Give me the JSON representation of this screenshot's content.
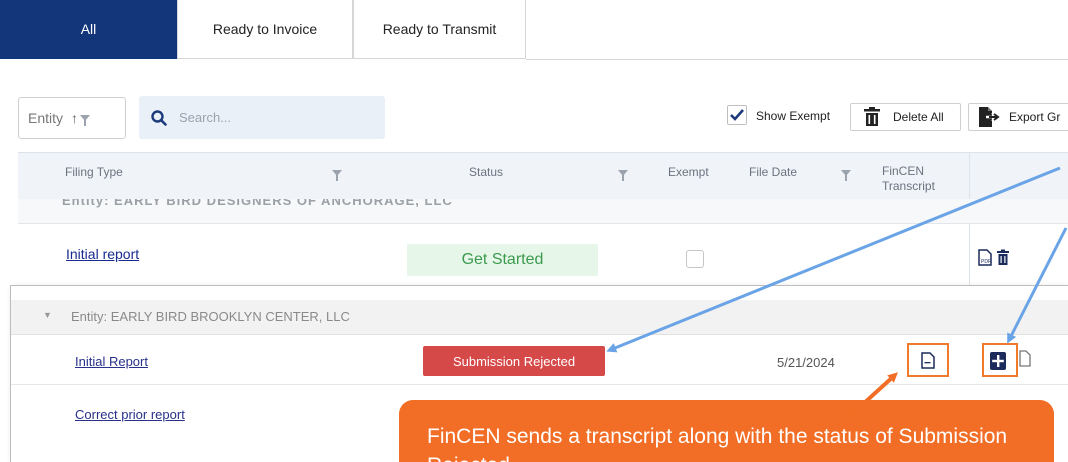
{
  "tabs": [
    {
      "label": "All",
      "active": true
    },
    {
      "label": "Ready to Invoice",
      "active": false
    },
    {
      "label": "Ready to Transmit",
      "active": false
    }
  ],
  "toolbar": {
    "entity_filter_label": "Entity",
    "search_placeholder": "Search...",
    "show_exempt_label": "Show Exempt",
    "show_exempt_checked": true,
    "delete_all_label": "Delete All",
    "export_label": "Export Gr"
  },
  "table": {
    "columns": [
      "Filing Type",
      "Status",
      "Exempt",
      "File Date",
      "FinCEN Transcript"
    ],
    "group_label": "Entity: EARLY BIRD DESIGNERS OF ANCHORAGE, LLC",
    "rows": [
      {
        "filing_type": "Initial report",
        "status": "Get Started",
        "exempt": false
      }
    ]
  },
  "overlay": {
    "group_label": "Entity: EARLY BIRD BROOKLYN CENTER, LLC",
    "rows": [
      {
        "filing_type": "Initial Report",
        "status": "Submission Rejected",
        "file_date": "5/21/2024"
      },
      {
        "filing_type": "Correct prior report"
      }
    ]
  },
  "callout": {
    "text": "FinCEN sends a transcript along with the status of Submission Rejected"
  },
  "colors": {
    "tab_active": "#13357a",
    "rejected": "#d64949",
    "get_started_bg": "#e6f7ea",
    "callout": "#f26d25",
    "highlight_border": "#f07a2a",
    "arrow": "#6aa4e6"
  }
}
